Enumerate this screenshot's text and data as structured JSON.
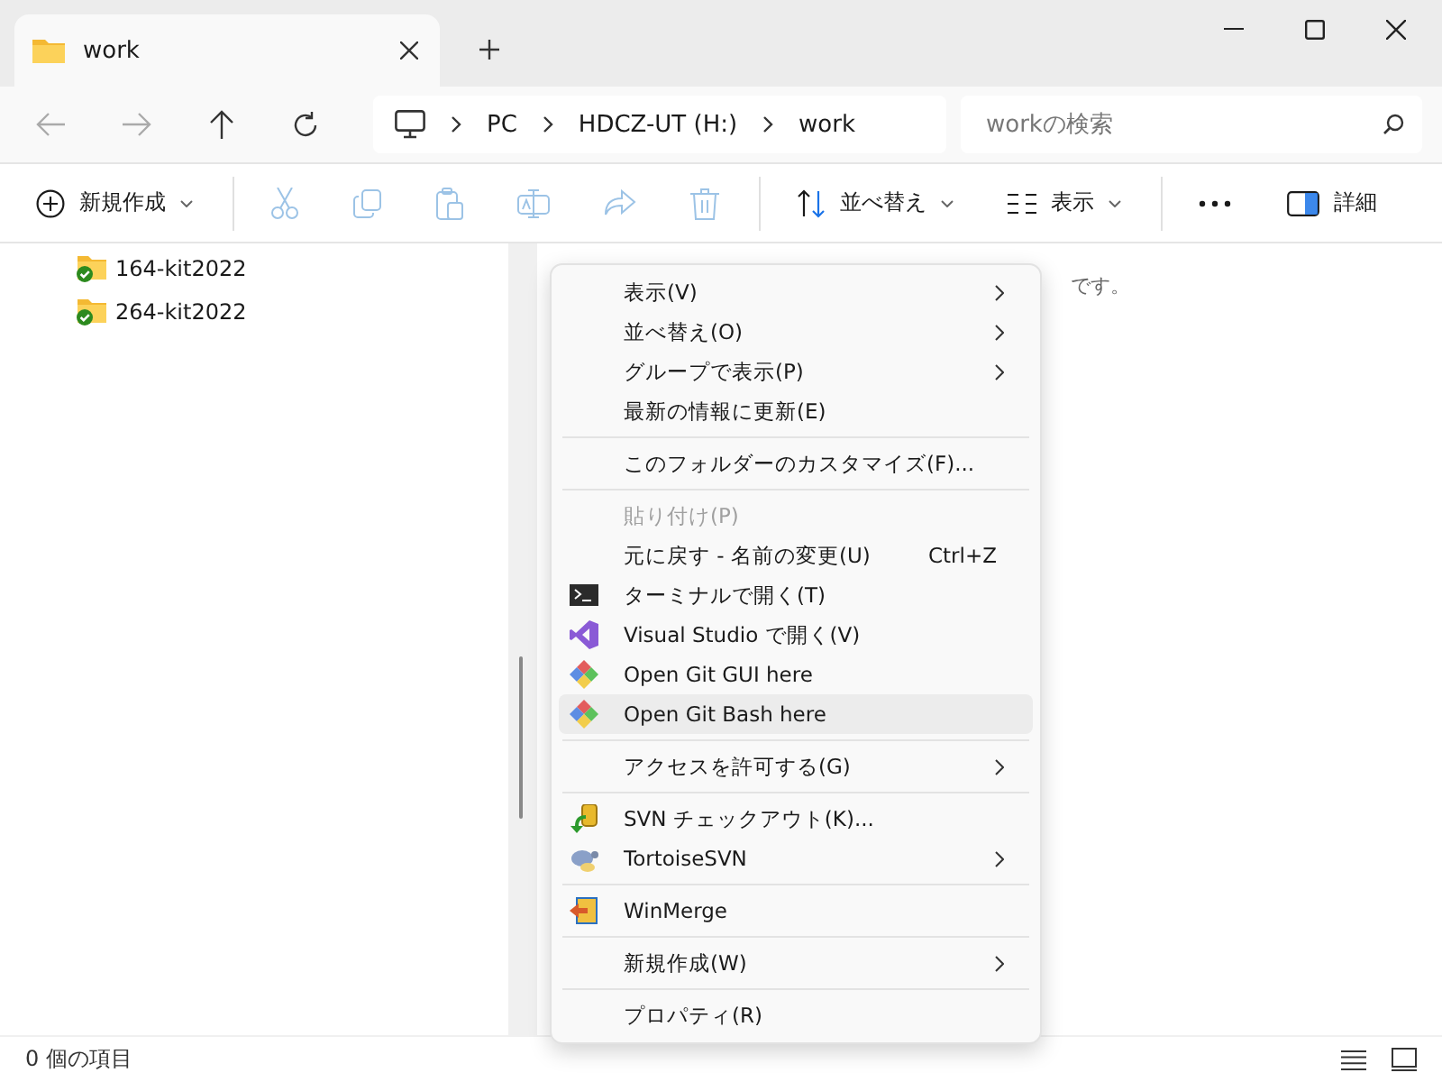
{
  "tab": {
    "title": "work",
    "selected": true
  },
  "address": {
    "crumbs": [
      "PC",
      "HDCZ-UT (H:)",
      "work"
    ]
  },
  "search": {
    "placeholder": "workの検索"
  },
  "toolbar": [
    {
      "kind": "new",
      "label": "新規作成",
      "disabled": false
    },
    {
      "kind": "cut",
      "disabled": true
    },
    {
      "kind": "copy",
      "disabled": true
    },
    {
      "kind": "paste",
      "disabled": true
    },
    {
      "kind": "rename",
      "disabled": true
    },
    {
      "kind": "share",
      "disabled": true
    },
    {
      "kind": "delete",
      "disabled": true
    },
    {
      "kind": "sort",
      "label": "並べ替え",
      "disabled": false
    },
    {
      "kind": "view",
      "label": "表示",
      "disabled": false
    },
    {
      "kind": "more",
      "disabled": false
    },
    {
      "kind": "details",
      "label": "詳細",
      "disabled": false
    }
  ],
  "sidebar": {
    "items": [
      {
        "label": "164-kit2022"
      },
      {
        "label": "264-kit2022"
      }
    ]
  },
  "content": {
    "empty_text": "です。"
  },
  "menu": {
    "groups": [
      [
        {
          "label": "表示(V)",
          "submenu": true,
          "disabled": false,
          "selected": false
        },
        {
          "label": "並べ替え(O)",
          "submenu": true,
          "disabled": false,
          "selected": false
        },
        {
          "label": "グループで表示(P)",
          "submenu": true,
          "disabled": false,
          "selected": false
        },
        {
          "label": "最新の情報に更新(E)",
          "submenu": false,
          "disabled": false,
          "selected": false
        }
      ],
      [
        {
          "label": "このフォルダーのカスタマイズ(F)...",
          "submenu": false,
          "disabled": false,
          "selected": false
        }
      ],
      [
        {
          "label": "貼り付け(P)",
          "submenu": false,
          "disabled": true,
          "selected": false
        },
        {
          "label": "元に戻す - 名前の変更(U)",
          "shortcut": "Ctrl+Z",
          "submenu": false,
          "disabled": false,
          "selected": false
        },
        {
          "label": "ターミナルで開く(T)",
          "kind": "terminal",
          "submenu": false,
          "disabled": false,
          "selected": false
        },
        {
          "label": "Visual Studio で開く(V)",
          "kind": "vs",
          "submenu": false,
          "disabled": false,
          "selected": false
        },
        {
          "label": "Open Git GUI here",
          "kind": "git",
          "submenu": false,
          "disabled": false,
          "selected": false
        },
        {
          "label": "Open Git Bash here",
          "kind": "git",
          "submenu": false,
          "disabled": false,
          "selected": true
        }
      ],
      [
        {
          "label": "アクセスを許可する(G)",
          "submenu": true,
          "disabled": false,
          "selected": false
        }
      ],
      [
        {
          "label": "SVN チェックアウト(K)...",
          "kind": "svn",
          "submenu": false,
          "disabled": false,
          "selected": false
        },
        {
          "label": "TortoiseSVN",
          "kind": "tortoise",
          "submenu": true,
          "disabled": false,
          "selected": false
        }
      ],
      [
        {
          "label": "WinMerge",
          "kind": "winmerge",
          "submenu": false,
          "disabled": false,
          "selected": false
        }
      ],
      [
        {
          "label": "新規作成(W)",
          "submenu": true,
          "disabled": false,
          "selected": false
        }
      ],
      [
        {
          "label": "プロパティ(R)",
          "submenu": false,
          "disabled": false,
          "selected": false
        }
      ]
    ]
  },
  "status_bar": {
    "count": "0 個の項目"
  }
}
